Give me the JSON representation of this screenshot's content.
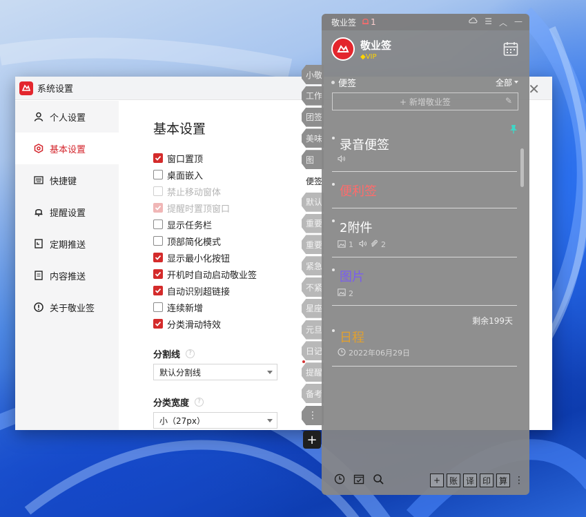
{
  "settings_window": {
    "title": "系统设置",
    "close_icon": "close-icon",
    "sidebar": [
      {
        "label": "个人设置",
        "icon": "user-icon"
      },
      {
        "label": "基本设置",
        "icon": "gear-icon",
        "active": true
      },
      {
        "label": "快捷键",
        "icon": "keyboard-icon"
      },
      {
        "label": "提醒设置",
        "icon": "bell-icon"
      },
      {
        "label": "定期推送",
        "icon": "scheduled-doc-icon"
      },
      {
        "label": "内容推送",
        "icon": "document-icon"
      },
      {
        "label": "关于敬业签",
        "icon": "info-icon"
      }
    ],
    "content": {
      "heading": "基本设置",
      "checkboxes": [
        {
          "label": "窗口置顶",
          "checked": true,
          "disabled": false
        },
        {
          "label": "桌面嵌入",
          "checked": false,
          "disabled": false
        },
        {
          "label": "禁止移动窗体",
          "checked": false,
          "disabled": true
        },
        {
          "label": "提醒时置顶窗口",
          "checked": true,
          "disabled": true
        },
        {
          "label": "显示任务栏",
          "checked": false,
          "disabled": false
        },
        {
          "label": "顶部简化模式",
          "checked": false,
          "disabled": false
        },
        {
          "label": "显示最小化按钮",
          "checked": true,
          "disabled": false
        },
        {
          "label": "开机时自动启动敬业签",
          "checked": true,
          "disabled": false
        },
        {
          "label": "自动识别超链接",
          "checked": true,
          "disabled": false
        },
        {
          "label": "连续新增",
          "checked": false,
          "disabled": false
        },
        {
          "label": "分类滑动特效",
          "checked": true,
          "disabled": false
        }
      ],
      "divider_section": {
        "label": "分割线",
        "value": "默认分割线"
      },
      "width_section": {
        "label": "分类宽度",
        "value": "小（27px）"
      }
    }
  },
  "category_tabs": {
    "items": [
      {
        "label": "小敬",
        "style": "dark"
      },
      {
        "label": "工作",
        "style": "dark"
      },
      {
        "label": "团签",
        "style": "dark"
      },
      {
        "label": "美味",
        "style": "dark"
      },
      {
        "label": "图",
        "style": "dark"
      },
      {
        "label": "便签",
        "style": "active"
      },
      {
        "label": "默认",
        "style": "light"
      },
      {
        "label": "重要",
        "style": "light"
      },
      {
        "label": "重要",
        "style": "light"
      },
      {
        "label": "紧急",
        "style": "light"
      },
      {
        "label": "不紧",
        "style": "light"
      },
      {
        "label": "星座",
        "style": "light"
      },
      {
        "label": "元旦",
        "style": "light"
      },
      {
        "label": "日记",
        "style": "light"
      },
      {
        "label": "提醒",
        "style": "light",
        "dot": true
      },
      {
        "label": "备考",
        "style": "light"
      }
    ],
    "more_label": "⋮",
    "add_label": "+"
  },
  "notes_panel": {
    "app_name": "敬业签",
    "bell_count": "1",
    "user_name": "敬业签",
    "vip_label": "VIP",
    "category": "便签",
    "filter_label": "全部",
    "new_placeholder": "新增敬业签",
    "notes": [
      {
        "title": "录音便签",
        "color": "#ffffff",
        "meta": [
          {
            "icon": "audio-icon",
            "text": ""
          }
        ]
      },
      {
        "title": "便利签",
        "color": "#ff6b6b",
        "meta": []
      },
      {
        "title": "2附件",
        "color": "#ffffff",
        "meta": [
          {
            "icon": "image-icon",
            "text": "1"
          },
          {
            "icon": "audio-icon",
            "text": ""
          },
          {
            "icon": "attachment-icon",
            "text": "2"
          }
        ]
      },
      {
        "title": "图片",
        "color": "#7a5cf0",
        "meta": [
          {
            "icon": "image-icon",
            "text": "2"
          }
        ]
      },
      {
        "title": "日程",
        "color": "#e0a030",
        "meta": [
          {
            "icon": "clock-icon",
            "text": "2022年06月29日"
          }
        ]
      }
    ],
    "remaining": "剩余199天",
    "bottom_buttons": [
      "+",
      "账",
      "译",
      "印",
      "算"
    ]
  }
}
